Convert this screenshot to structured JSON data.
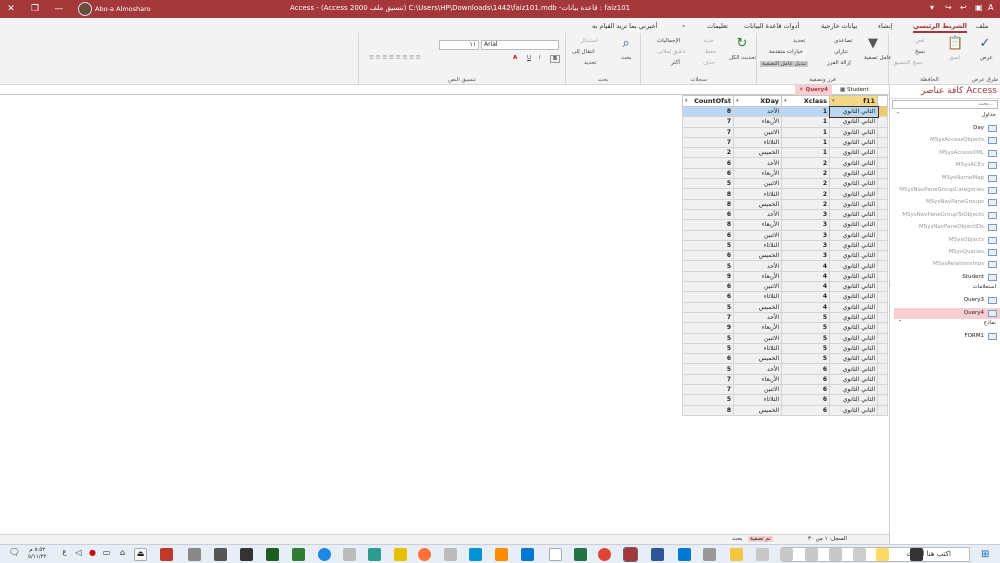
{
  "titlebar": {
    "text": "Access  -  (Access 2000 تنسيق ملف) C:\\Users\\HP\\Downloads\\1442\\faiz101.mdb -قاعدة بيانات : faiz101",
    "user": "Abo-a Almosharo"
  },
  "tabs": [
    "ملف",
    "الشريط الرئيسي",
    "إنشاء",
    "بيانات خارجية",
    "أدوات قاعدة البيانات",
    "تعليمات",
    "أخبرني بما تريد القيام به"
  ],
  "ribbon": {
    "views": {
      "view": "عرض",
      "group": "طرق عرض"
    },
    "clipboard": {
      "paste": "لصق",
      "cut": "قص",
      "copy": "نسخ",
      "painter": "نسخ التنسيق",
      "group": "الحافظة"
    },
    "sort": {
      "filter": "عامل تصفية",
      "asc": "تصاعدي",
      "desc": "تنازلي",
      "remove": "إزالة الفرز",
      "selection": "تحديد",
      "advanced": "خيارات متقدمة",
      "toggle": "تبديل عامل التصفية",
      "group": "فرز وتصفية"
    },
    "records": {
      "refresh": "تحديث الكل",
      "new": "جديد",
      "save": "حفظ",
      "delete": "حذف",
      "totals": "الإجماليات",
      "spelling": "تدقيق إملائي",
      "more": "أكثر",
      "group": "سجلات"
    },
    "find": {
      "find": "بحث",
      "replace": "استبدال",
      "goto": "انتقال إلى",
      "select": "تحديد",
      "group": "بحث"
    },
    "text": {
      "font": "Arial",
      "size": "١١",
      "group": "تنسيق النص"
    }
  },
  "nav": {
    "title": "كافة عناصر Access",
    "search": "بحث...",
    "tables_label": "جداول",
    "tables": [
      "Day",
      "MSysAccessObjects",
      "MSysAccessXML",
      "MSysACEs",
      "MSysNameMap",
      "MSysNavPaneGroupCategories",
      "MSysNavPaneGroups",
      "MSysNavPaneGroupToObjects",
      "MSysNavPaneObjectIDs",
      "MSysObjects",
      "MSysQueries",
      "MSysRelationships",
      "Student"
    ],
    "queries_label": "استعلامات",
    "queries": [
      "Query3",
      "Query4"
    ],
    "forms_label": "نماذج",
    "forms": [
      "FORM1"
    ]
  },
  "doc": {
    "tab_student": "Student",
    "tab_query": "Query4",
    "columns": [
      "f11",
      "Xclass",
      "XDay",
      "CountOfst"
    ],
    "rows": [
      [
        "الثاني الثانوي",
        "1",
        "الأحد",
        "8"
      ],
      [
        "الثاني الثانوي",
        "1",
        "الأربعاء",
        "7"
      ],
      [
        "الثاني الثانوي",
        "1",
        "الاثنين",
        "7"
      ],
      [
        "الثاني الثانوي",
        "1",
        "الثلاثاء",
        "7"
      ],
      [
        "الثاني الثانوي",
        "1",
        "الخميس",
        "2"
      ],
      [
        "الثاني الثانوي",
        "2",
        "الأحد",
        "6"
      ],
      [
        "الثاني الثانوي",
        "2",
        "الأربعاء",
        "6"
      ],
      [
        "الثاني الثانوي",
        "2",
        "الاثنين",
        "5"
      ],
      [
        "الثاني الثانوي",
        "2",
        "الثلاثاء",
        "8"
      ],
      [
        "الثاني الثانوي",
        "2",
        "الخميس",
        "8"
      ],
      [
        "الثاني الثانوي",
        "3",
        "الأحد",
        "6"
      ],
      [
        "الثاني الثانوي",
        "3",
        "الأربعاء",
        "8"
      ],
      [
        "الثاني الثانوي",
        "3",
        "الاثنين",
        "6"
      ],
      [
        "الثاني الثانوي",
        "3",
        "الثلاثاء",
        "5"
      ],
      [
        "الثاني الثانوي",
        "3",
        "الخميس",
        "6"
      ],
      [
        "الثاني الثانوي",
        "4",
        "الأحد",
        "5"
      ],
      [
        "الثاني الثانوي",
        "4",
        "الأربعاء",
        "9"
      ],
      [
        "الثاني الثانوي",
        "4",
        "الاثنين",
        "6"
      ],
      [
        "الثاني الثانوي",
        "4",
        "الثلاثاء",
        "6"
      ],
      [
        "الثاني الثانوي",
        "4",
        "الخميس",
        "5"
      ],
      [
        "الثاني الثانوي",
        "5",
        "الأحد",
        "7"
      ],
      [
        "الثاني الثانوي",
        "5",
        "الأربعاء",
        "9"
      ],
      [
        "الثاني الثانوي",
        "5",
        "الاثنين",
        "5"
      ],
      [
        "الثاني الثانوي",
        "5",
        "الثلاثاء",
        "5"
      ],
      [
        "الثاني الثانوي",
        "5",
        "الخميس",
        "6"
      ],
      [
        "الثاني الثانوي",
        "6",
        "الأحد",
        "5"
      ],
      [
        "الثاني الثانوي",
        "6",
        "الأربعاء",
        "7"
      ],
      [
        "الثاني الثانوي",
        "6",
        "الاثنين",
        "7"
      ],
      [
        "الثاني الثانوي",
        "6",
        "الثلاثاء",
        "5"
      ],
      [
        "الثاني الثانوي",
        "6",
        "الخميس",
        "8"
      ]
    ]
  },
  "status": {
    "record": "السجل: ١ من ٣٠",
    "filter": "تم تصفية",
    "search": "بحث"
  },
  "taskbar": {
    "search": "اكتب هنا للبحث",
    "time": "٥:٥٢ م",
    "date": "٥/١١/٢٢"
  },
  "colors": {
    "accent": "#a4373a",
    "select": "#b9d6f3"
  }
}
